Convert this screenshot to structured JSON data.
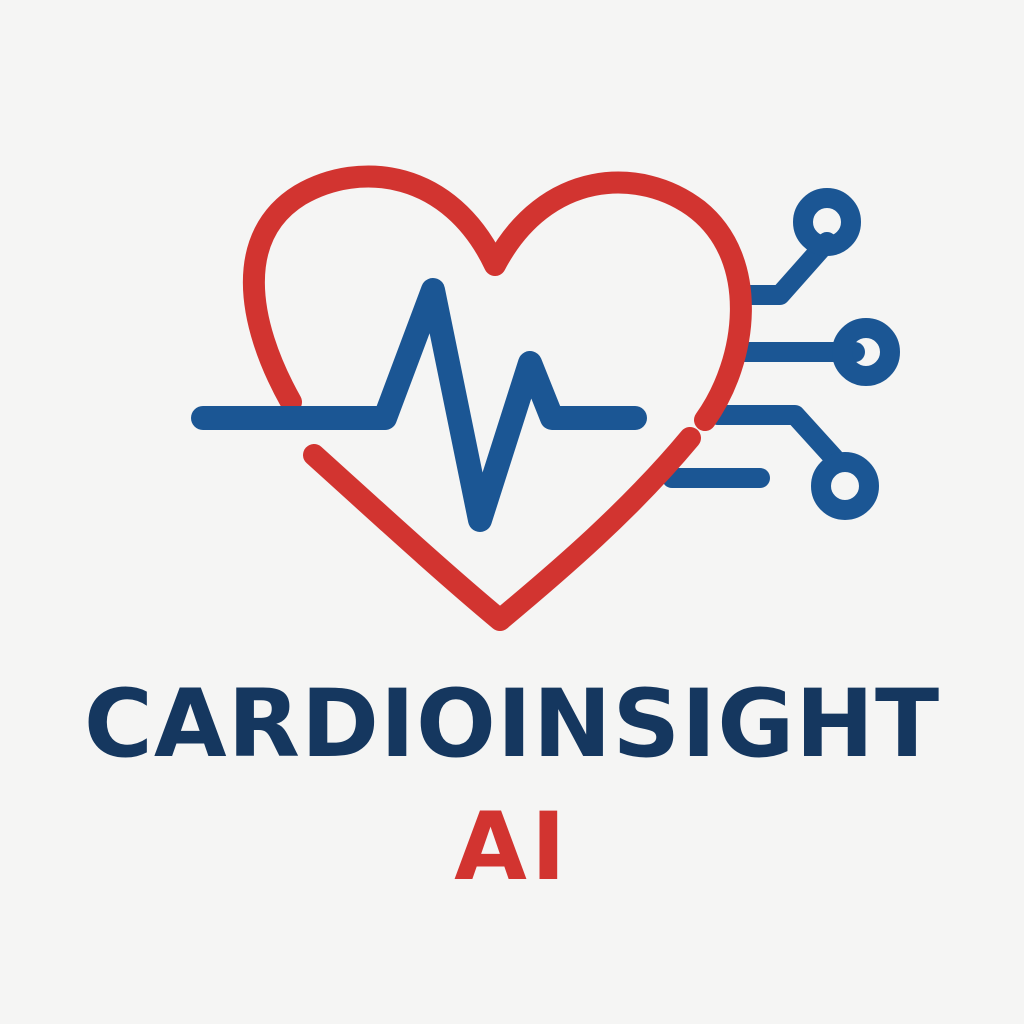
{
  "brand": {
    "name": "CARDIOINSIGHT",
    "suffix": "AI"
  },
  "colors": {
    "background": "#f5f5f4",
    "heart": "#d23430",
    "pulse": "#1b5694",
    "circuit": "#1b5694",
    "name_text": "#15375f",
    "suffix_text": "#d23430"
  },
  "icons": {
    "heart": "heart-icon",
    "pulse": "heartbeat-pulse-icon",
    "circuit": "circuit-traces-icon"
  }
}
